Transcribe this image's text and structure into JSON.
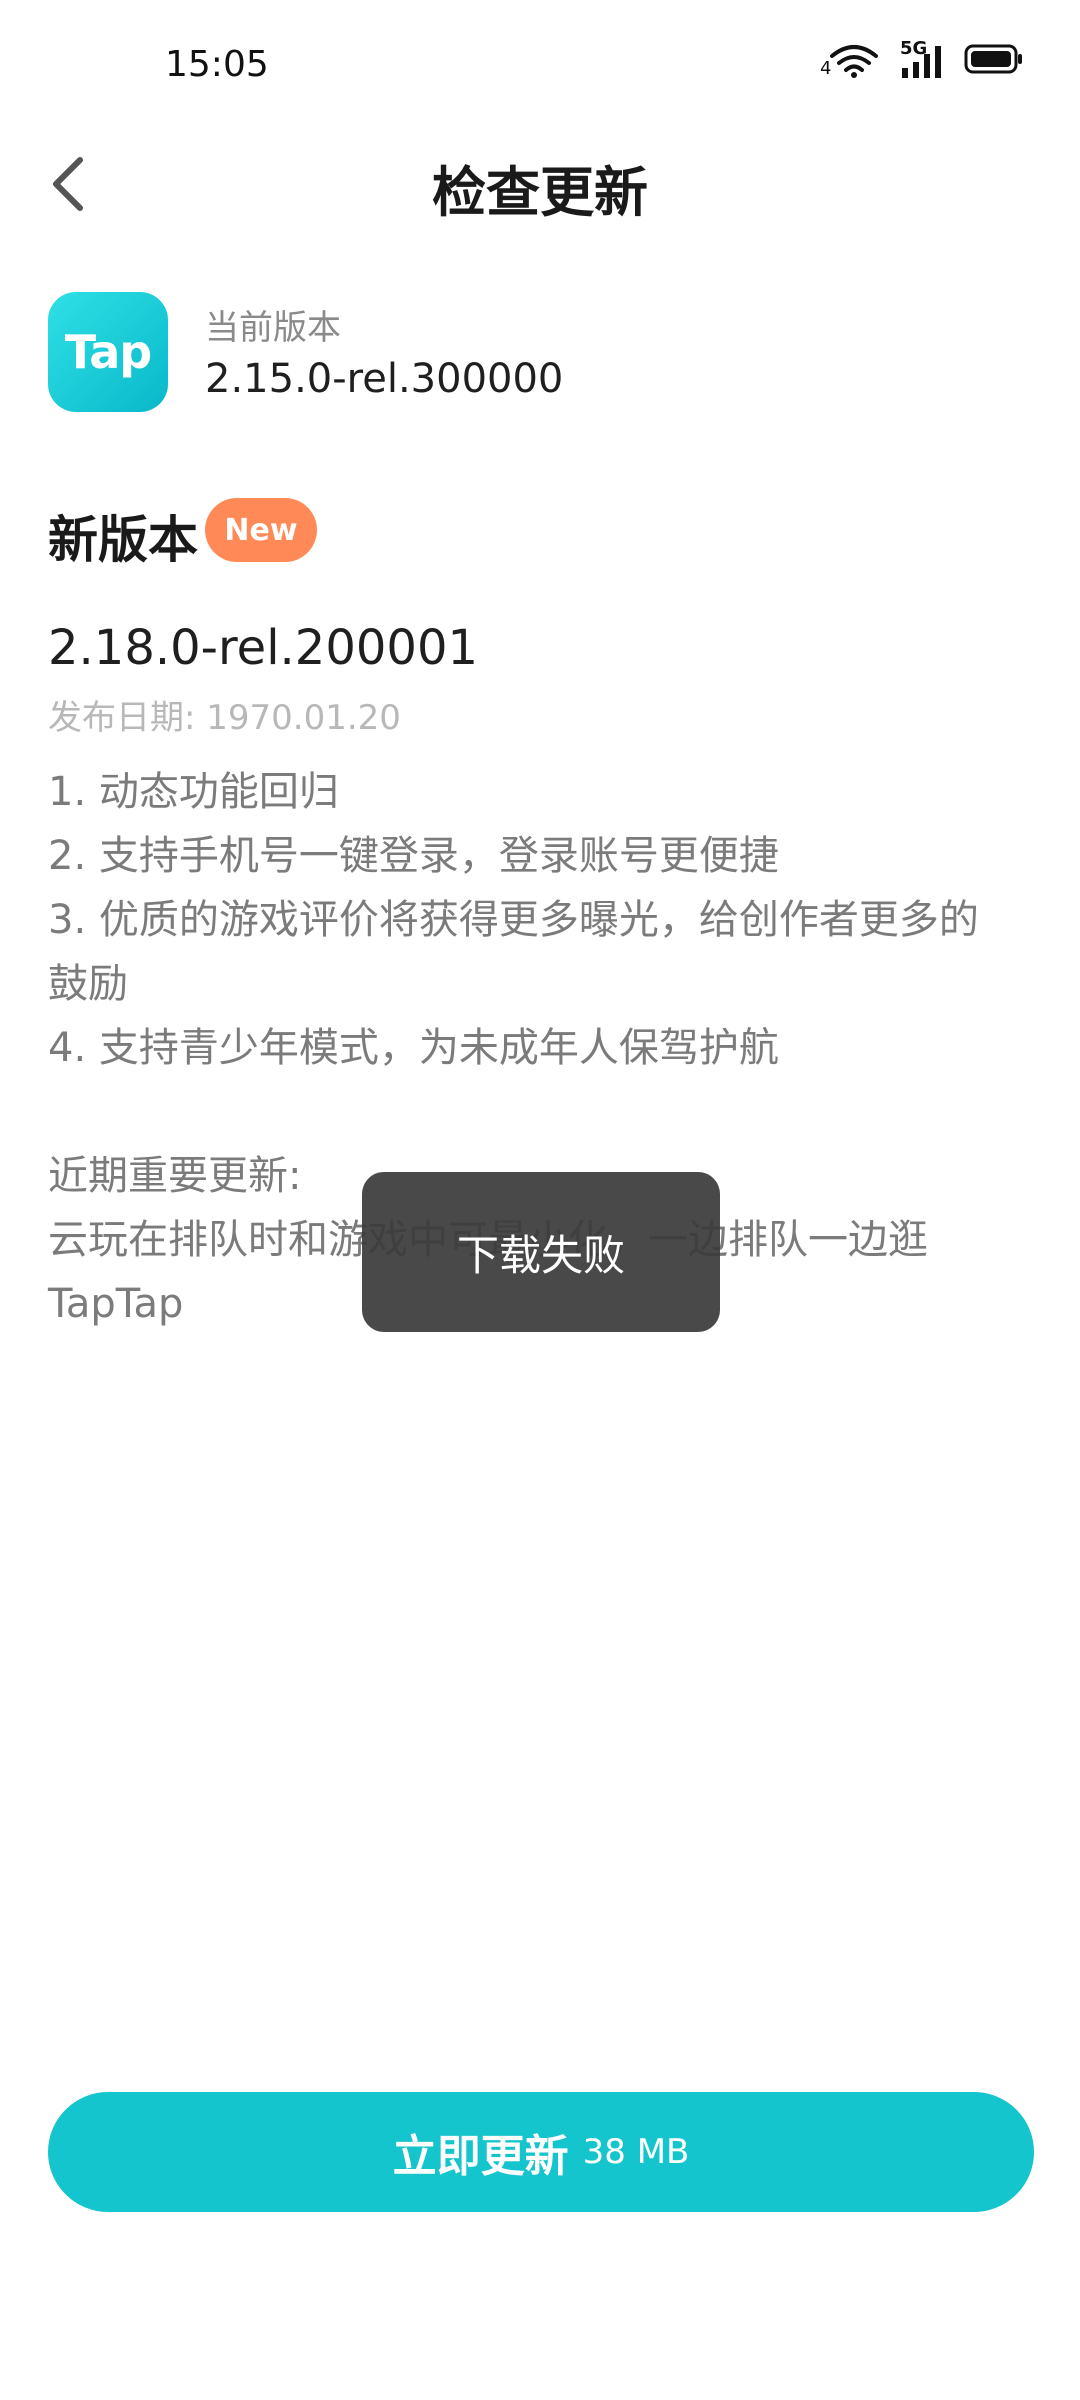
{
  "status_bar": {
    "time": "15:05",
    "network_label": "5G",
    "wifi_sub": "4"
  },
  "header": {
    "title": "检查更新"
  },
  "current": {
    "icon_text": "Tap",
    "label": "当前版本",
    "version": "2.15.0-rel.300000"
  },
  "new_version": {
    "title": "新版本",
    "badge": "New",
    "version": "2.18.0-rel.200001",
    "release_date": "发布日期: 1970.01.20",
    "notes": [
      "1. 动态功能回归",
      "2. 支持手机号一键登录，登录账号更便捷",
      "3. 优质的游戏评价将获得更多曝光，给创作者更多的",
      "鼓励",
      "4. 支持青少年模式，为未成年人保驾护航"
    ],
    "recent_title": "近期重要更新:",
    "recent_lines": [
      "云玩在排队时和游戏中可最小化，一边排队一边逛",
      "TapTap"
    ]
  },
  "toast": {
    "text": "下载失败"
  },
  "update_button": {
    "label": "立即更新",
    "size": "38 MB"
  },
  "colors": {
    "accent": "#15c5cd",
    "badge": "#ff8a57",
    "toast_bg": "#3a3a3a"
  }
}
